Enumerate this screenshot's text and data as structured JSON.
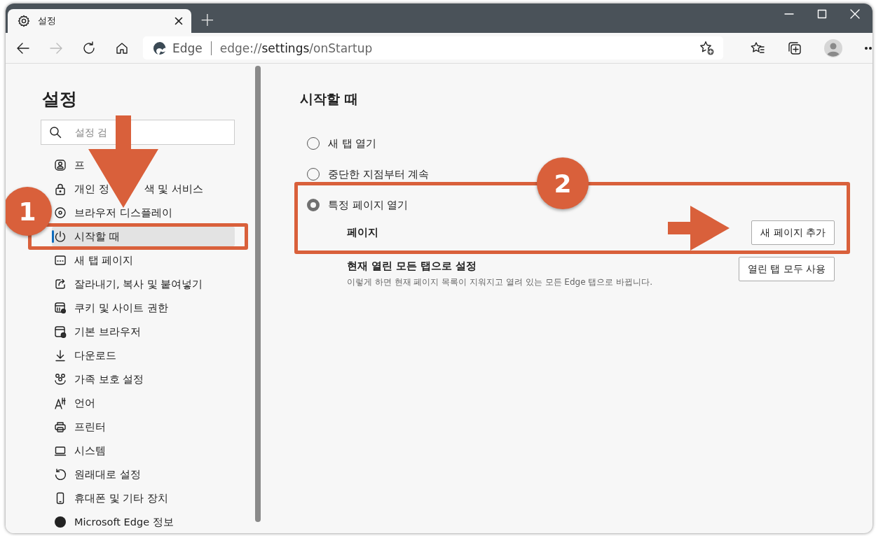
{
  "window": {
    "tab_title": "설정",
    "new_tab": "+"
  },
  "toolbar": {
    "site_label": "Edge",
    "url_prefix": "edge://",
    "url_host": "settings",
    "url_path": "/onStartup"
  },
  "sidebar": {
    "title": "설정",
    "search": {
      "placeholder": "설정 검"
    },
    "items": [
      {
        "label": "프",
        "selected": false
      },
      {
        "label": "개인 정",
        "label_after": "색 및 서비스",
        "selected": false
      },
      {
        "label": "브라우저 디스플레이",
        "selected": false
      },
      {
        "label": "시작할 때",
        "selected": true
      },
      {
        "label": "새 탭 페이지",
        "selected": false
      },
      {
        "label": "잘라내기, 복사 및 붙여넣기",
        "selected": false
      },
      {
        "label": "쿠키 및 사이트 권한",
        "selected": false
      },
      {
        "label": "기본 브라우저",
        "selected": false
      },
      {
        "label": "다운로드",
        "selected": false
      },
      {
        "label": "가족 보호 설정",
        "selected": false
      },
      {
        "label": "언어",
        "selected": false
      },
      {
        "label": "프린터",
        "selected": false
      },
      {
        "label": "시스템",
        "selected": false
      },
      {
        "label": "원래대로 설정",
        "selected": false
      },
      {
        "label": "휴대폰 및 기타 장치",
        "selected": false
      },
      {
        "label": "Microsoft Edge 정보",
        "selected": false
      }
    ]
  },
  "main": {
    "title": "시작할 때",
    "options": [
      {
        "label": "새 탭 열기",
        "selected": false
      },
      {
        "label": "중단한 지점부터 계속",
        "selected": false
      },
      {
        "label": "특정 페이지 열기",
        "selected": true
      }
    ],
    "pages": {
      "label": "페이지",
      "button": "새 페이지 추가"
    },
    "use_open_tabs": {
      "title": "현재 열린 모든 탭으로 설정",
      "description": "이렇게 하면 현재 페이지 목록이 지워지고 열려 있는 모든 Edge 탭으로 바뀝니다.",
      "button": "열린 탭 모두 사용"
    }
  },
  "annotations": [
    {
      "label": "1"
    },
    {
      "label": "2"
    }
  ]
}
